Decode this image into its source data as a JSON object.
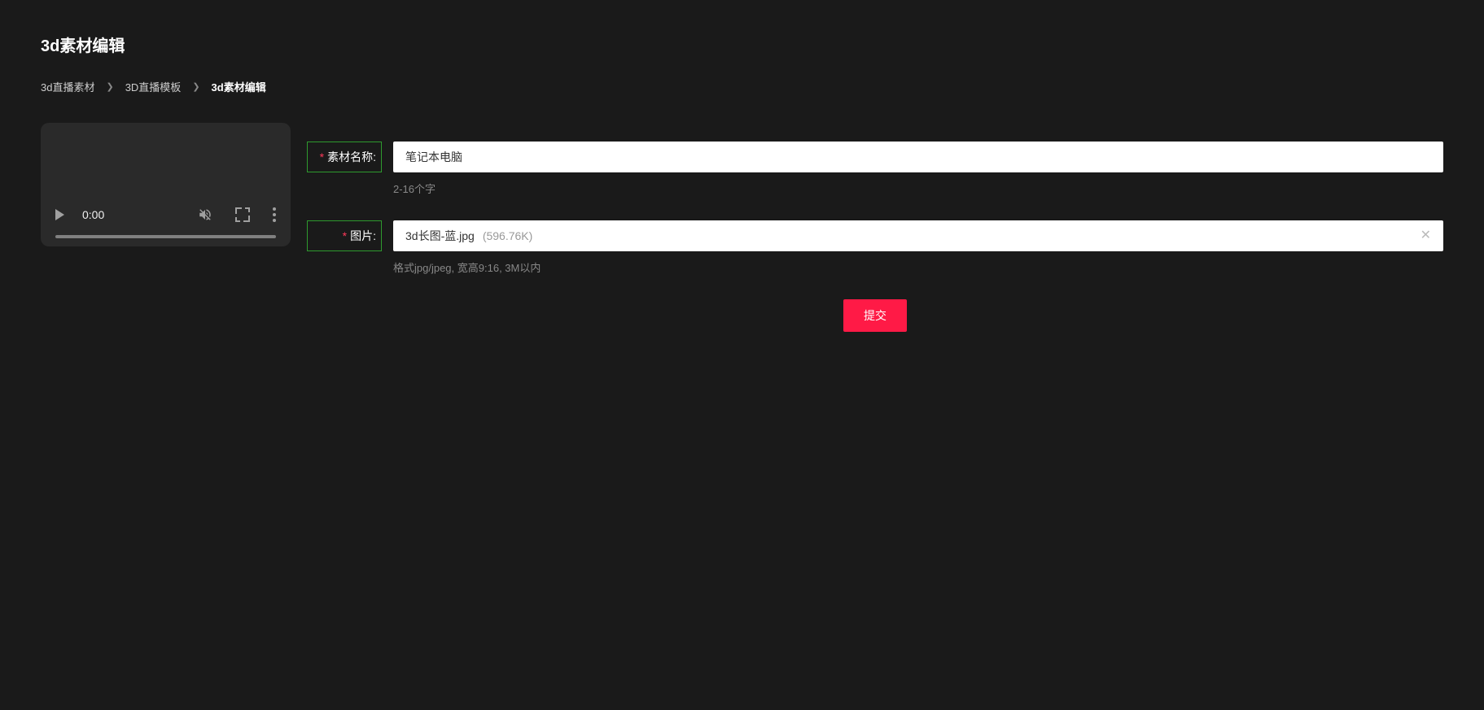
{
  "page": {
    "title": "3d素材编辑"
  },
  "breadcrumb": {
    "items": [
      {
        "label": "3d直播素材",
        "current": false
      },
      {
        "label": "3D直播模板",
        "current": false
      },
      {
        "label": "3d素材编辑",
        "current": true
      }
    ]
  },
  "video": {
    "time": "0:00"
  },
  "form": {
    "name": {
      "label": "素材名称:",
      "value": "笔记本电脑",
      "hint": "2-16个字"
    },
    "image": {
      "label": "图片:",
      "filename": "3d长图-蓝.jpg",
      "filesize": "(596.76K)",
      "hint": "格式jpg/jpeg, 宽高9:16, 3M以内"
    },
    "submit_label": "提交"
  }
}
